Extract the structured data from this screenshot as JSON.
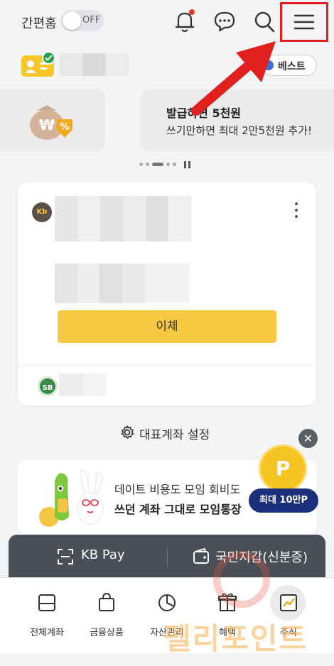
{
  "header": {
    "simple_home_label": "간편홈",
    "toggle_state": "OFF",
    "icons": [
      "bell-icon",
      "chat-icon",
      "search-icon",
      "menu-icon"
    ],
    "notification_dot_color": "#e63a2c",
    "highlight_color": "#e0201f"
  },
  "profile": {
    "best_label": "베스트"
  },
  "banner": {
    "title": "발급하면 5천원",
    "subtitle": "쓰기만하면 최대 2만5천원 추가!"
  },
  "account_card": {
    "transfer_label": "이체",
    "bank_logo_text": "Kb",
    "sub_logo_text": "SB",
    "accent_color": "#f7c942"
  },
  "settings": {
    "main_account_label": "대표계좌 설정"
  },
  "promo": {
    "line1": "데이트 비용도 모임 회비도",
    "line2": "쓰던 계좌 그대로 모임통장",
    "coin_letter": "P",
    "max_badge": "최대 10만P"
  },
  "pay_bar": {
    "kb_pay_label": "KB Pay",
    "wallet_label": "국민지갑(신분증)"
  },
  "bottom_nav": {
    "items": [
      {
        "label": "전체계좌",
        "icon": "wallet-card-icon"
      },
      {
        "label": "금융상품",
        "icon": "shopping-bag-icon"
      },
      {
        "label": "자산관리",
        "icon": "pie-chart-icon"
      },
      {
        "label": "혜택",
        "icon": "gift-icon"
      },
      {
        "label": "주식",
        "icon": "stock-chart-icon"
      }
    ],
    "active_index": 4
  },
  "watermark": {
    "text": "펠리포인트"
  }
}
